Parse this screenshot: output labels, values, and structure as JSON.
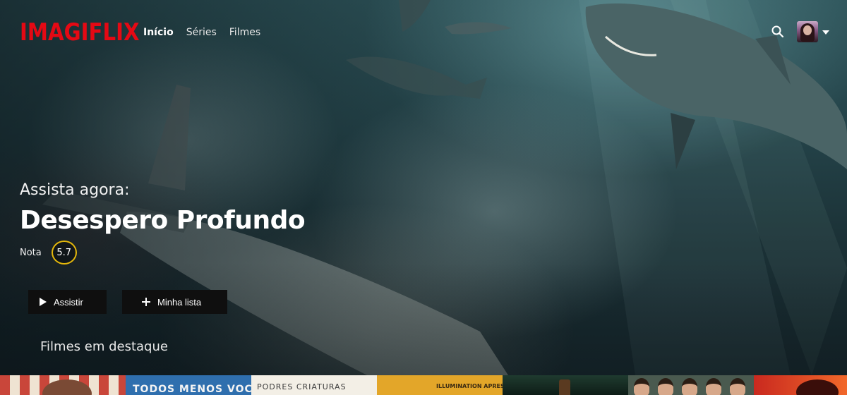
{
  "app": {
    "logo_text": "IMAGIFLIX",
    "brand_color": "#e50914"
  },
  "nav": {
    "items": [
      {
        "label": "Início",
        "active": true
      },
      {
        "label": "Séries",
        "active": false
      },
      {
        "label": "Filmes",
        "active": false
      }
    ]
  },
  "header_icons": {
    "search": "search-icon",
    "profile": "avatar",
    "menu": "chevron-down-icon"
  },
  "featured": {
    "eyebrow": "Assista agora:",
    "title": "Desespero Profundo",
    "rating_label": "Nota",
    "rating_value": "5.7",
    "rating_ring_color": "#e5b80b",
    "play_label": "Assistir",
    "mylist_label": "Minha lista"
  },
  "rows": {
    "featured_title": "Filmes em destaque",
    "posters": [
      {
        "text": ""
      },
      {
        "text": "TODOS MENOS VOCÊ"
      },
      {
        "text": "PODRES CRIATURAS"
      },
      {
        "text": "ILLUMINATION APRESENTA"
      },
      {
        "text": ""
      },
      {
        "text": ""
      },
      {
        "text": ""
      }
    ]
  }
}
